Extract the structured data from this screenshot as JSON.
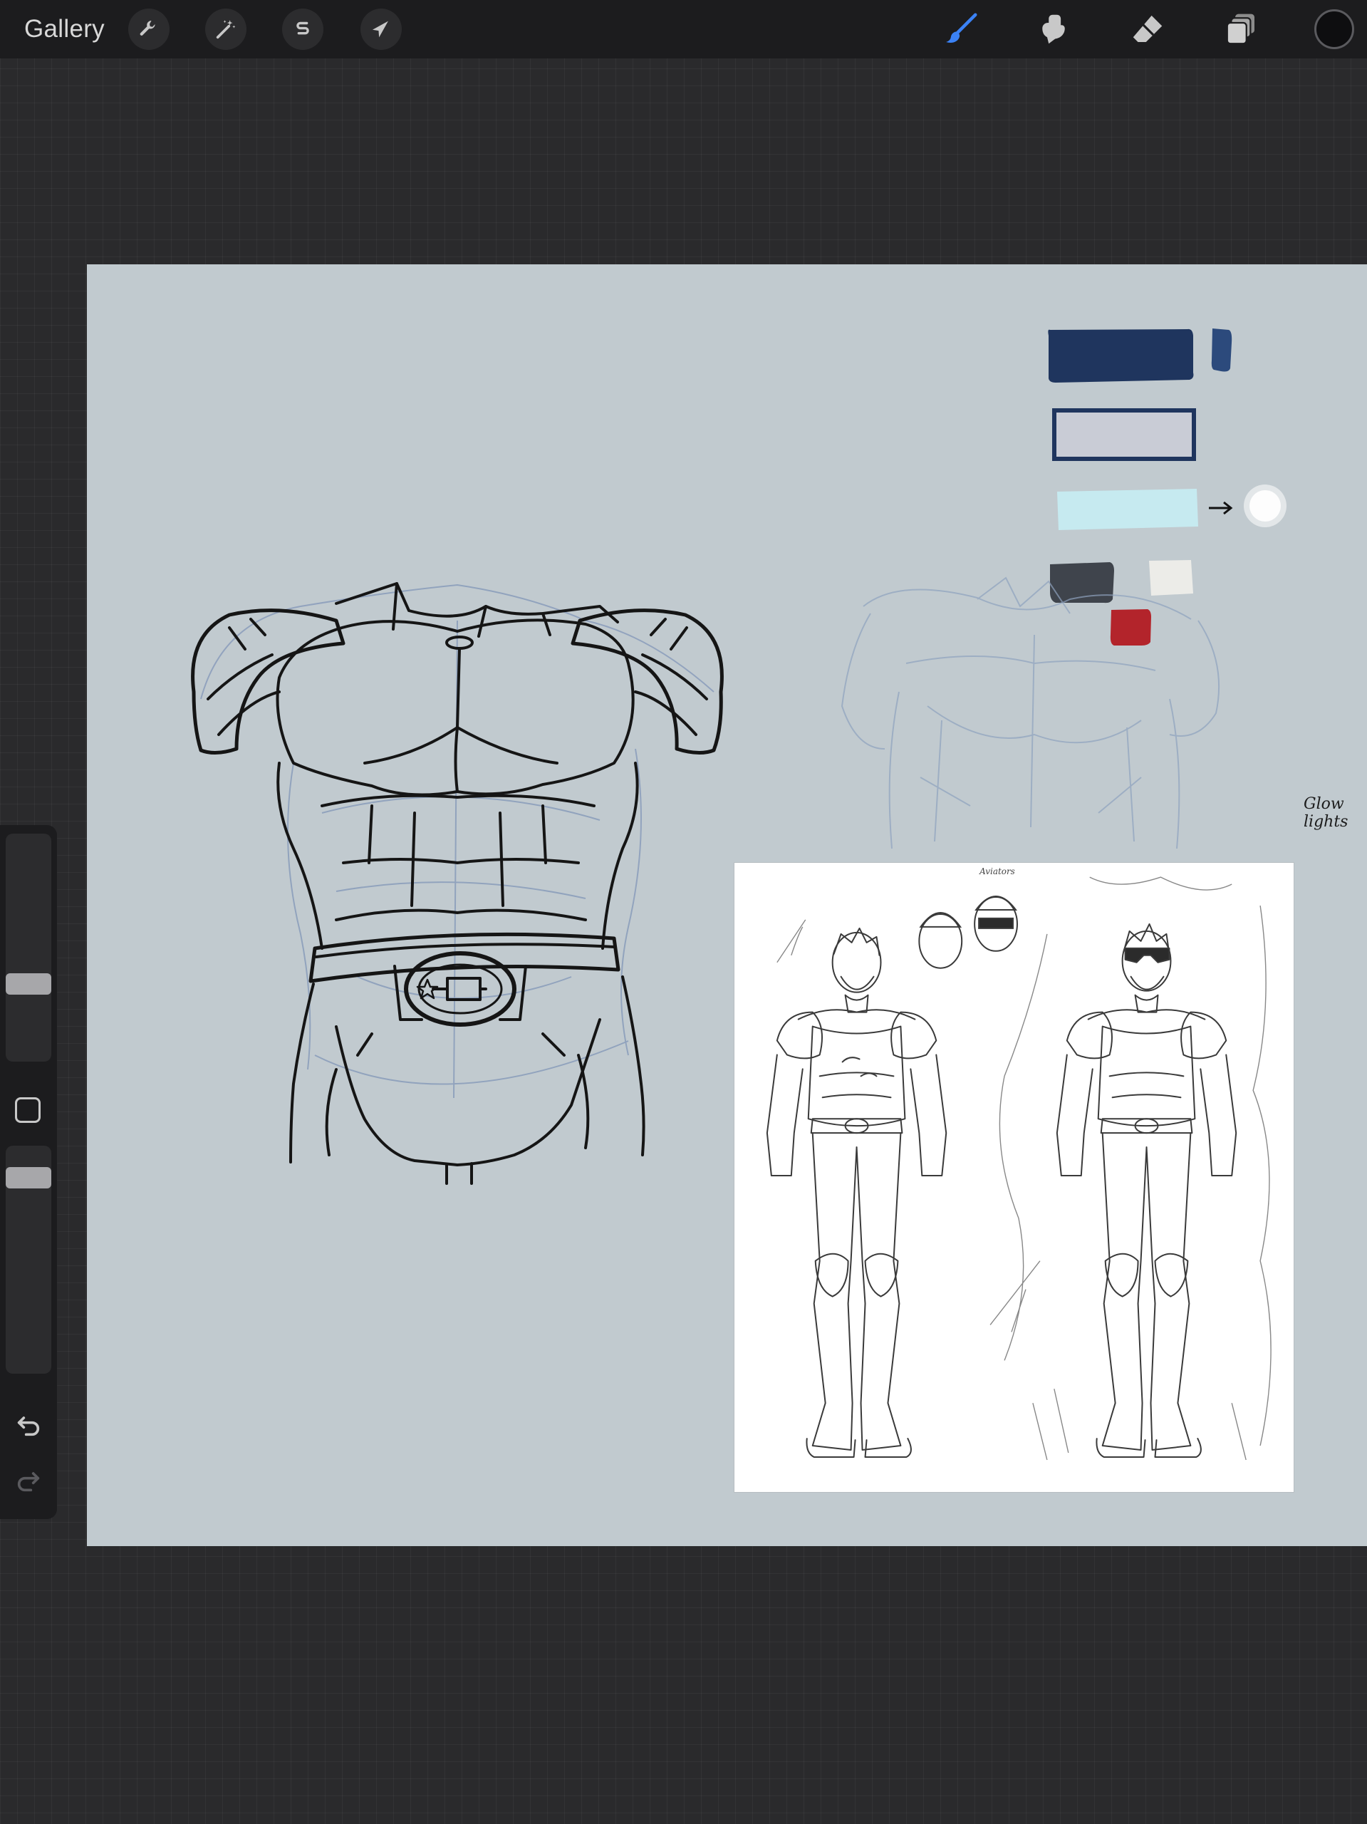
{
  "toolbar": {
    "gallery_label": "Gallery",
    "left_tools": [
      {
        "name": "actions",
        "icon": "wrench-icon"
      },
      {
        "name": "adjustments",
        "icon": "magic-wand-icon"
      },
      {
        "name": "selection",
        "icon": "selection-s-icon"
      },
      {
        "name": "transform",
        "icon": "arrow-cursor-icon"
      }
    ],
    "right_tools": [
      {
        "name": "brush",
        "icon": "brush-icon",
        "active": true
      },
      {
        "name": "smudge",
        "icon": "smudge-icon",
        "active": false
      },
      {
        "name": "eraser",
        "icon": "eraser-icon",
        "active": false
      },
      {
        "name": "layers",
        "icon": "layers-icon",
        "active": false
      }
    ],
    "current_color": "#0e0e10",
    "active_color": "#3b82f6"
  },
  "canvas": {
    "background": "#c1cacf",
    "palette_swatches": [
      "#1f355e",
      "#c9ccd6",
      "#c6eaf0",
      "#3f444c",
      "#ecece8",
      "#b3242b"
    ],
    "glow_note": "Glow lights",
    "reference_annotation": "Aviators"
  },
  "sidebar": {
    "brush_size_icon": "slider-thumb",
    "modify_icon": "square-icon",
    "opacity_icon": "slider-thumb",
    "undo_icon": "undo-icon",
    "redo_icon": "redo-icon"
  }
}
